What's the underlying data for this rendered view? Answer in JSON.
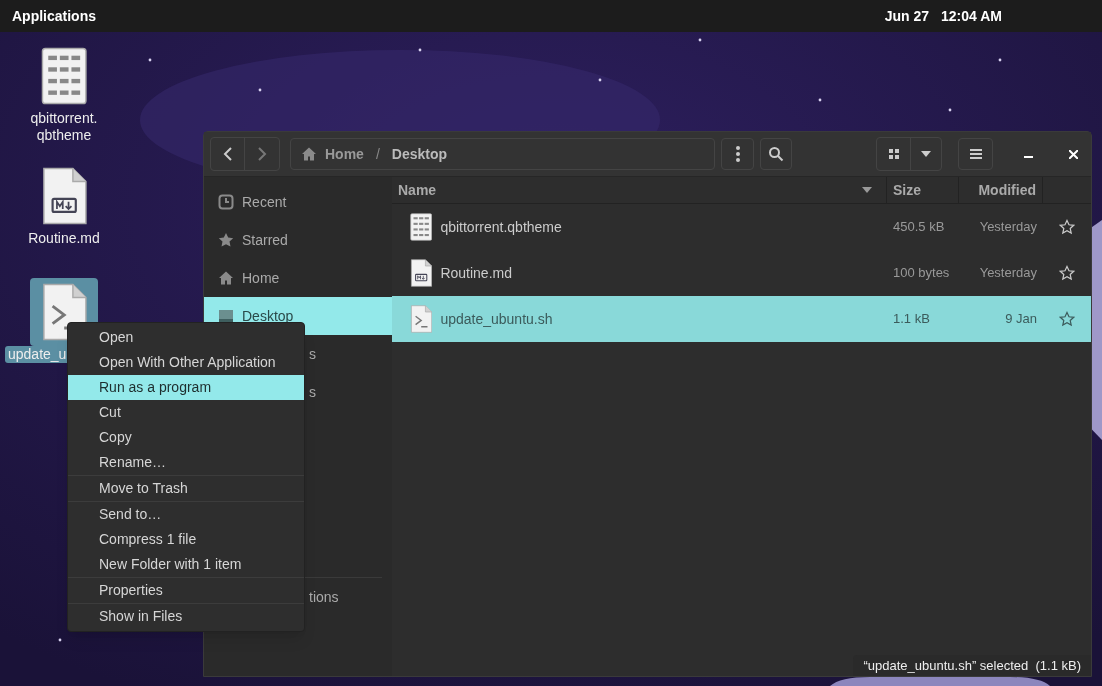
{
  "top_bar": {
    "menu": "Applications",
    "date": "Jun 27",
    "time": "12:04 AM"
  },
  "desktop_icons": [
    {
      "kind": "hex",
      "label_lines": [
        "qbittorrent.",
        "qbtheme"
      ],
      "selected": false
    },
    {
      "kind": "markdown",
      "label_lines": [
        "Routine.md"
      ],
      "selected": false
    },
    {
      "kind": "script",
      "label_lines": [
        "update_u"
      ],
      "selected": true
    }
  ],
  "files_window": {
    "path": [
      "Home",
      "Desktop"
    ],
    "path_separator": "/",
    "sidebar": [
      {
        "label": "Recent",
        "kind": "recent",
        "selected": false
      },
      {
        "label": "Starred",
        "kind": "starred",
        "selected": false
      },
      {
        "label": "Home",
        "kind": "home",
        "selected": false
      },
      {
        "label": "Desktop",
        "kind": "desktop",
        "selected": true
      },
      {
        "label": "s",
        "kind": "cut",
        "selected": false
      },
      {
        "label": "s",
        "kind": "cut",
        "selected": false
      },
      {
        "label": "tions",
        "kind": "cut_bottom",
        "selected": false
      }
    ],
    "columns": [
      "Name",
      "Size",
      "Modified"
    ],
    "rows": [
      {
        "kind": "hex",
        "name": "qbittorrent.qbtheme",
        "size": "450.5 kB",
        "modified": "Yesterday",
        "selected": false
      },
      {
        "kind": "markdown",
        "name": "Routine.md",
        "size": "100 bytes",
        "modified": "Yesterday",
        "selected": false
      },
      {
        "kind": "script",
        "name": "update_ubuntu.sh",
        "size": "1.1 kB",
        "modified": "9 Jan",
        "selected": true
      }
    ],
    "status": "“update_ubuntu.sh” selected  (1.1 kB)"
  },
  "context_menu": {
    "groups": [
      [
        {
          "label": "Open",
          "selected": false
        },
        {
          "label": "Open With Other Application",
          "selected": false
        },
        {
          "label": "Run as a program",
          "selected": true
        },
        {
          "label": "Cut",
          "selected": false
        },
        {
          "label": "Copy",
          "selected": false
        },
        {
          "label": "Rename…",
          "selected": false
        }
      ],
      [
        {
          "label": "Move to Trash",
          "selected": false
        }
      ],
      [
        {
          "label": "Send to…",
          "selected": false
        },
        {
          "label": "Compress 1 file",
          "selected": false
        },
        {
          "label": "New Folder with 1 item",
          "selected": false
        }
      ],
      [
        {
          "label": "Properties",
          "selected": false
        }
      ],
      [
        {
          "label": "Show in Files",
          "selected": false
        }
      ]
    ]
  }
}
